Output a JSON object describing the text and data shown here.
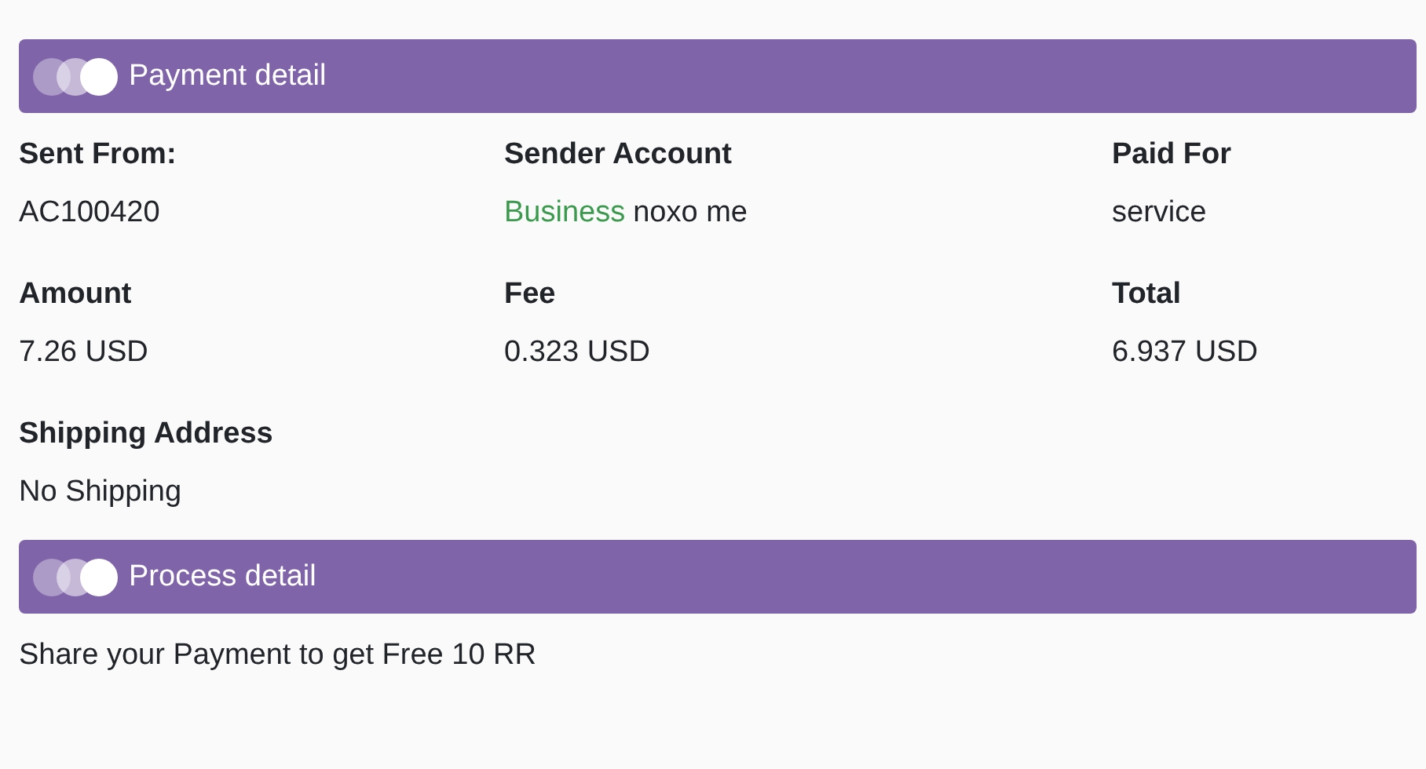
{
  "sections": [
    {
      "title": "Payment detail",
      "fields": [
        {
          "label": "Sent From:",
          "value": "AC100420"
        },
        {
          "label": "Sender Account",
          "tag": "Business",
          "value": "noxo me"
        },
        {
          "label": "Paid For",
          "value": "service"
        },
        {
          "label": "Amount",
          "value": "7.26 USD"
        },
        {
          "label": "Fee",
          "value": "0.323 USD"
        },
        {
          "label": "Total",
          "value": "6.937 USD"
        },
        {
          "label": "Shipping Address",
          "value": "No Shipping"
        }
      ]
    },
    {
      "title": "Process detail",
      "text": "Share your Payment to get Free 10 RR"
    }
  ]
}
